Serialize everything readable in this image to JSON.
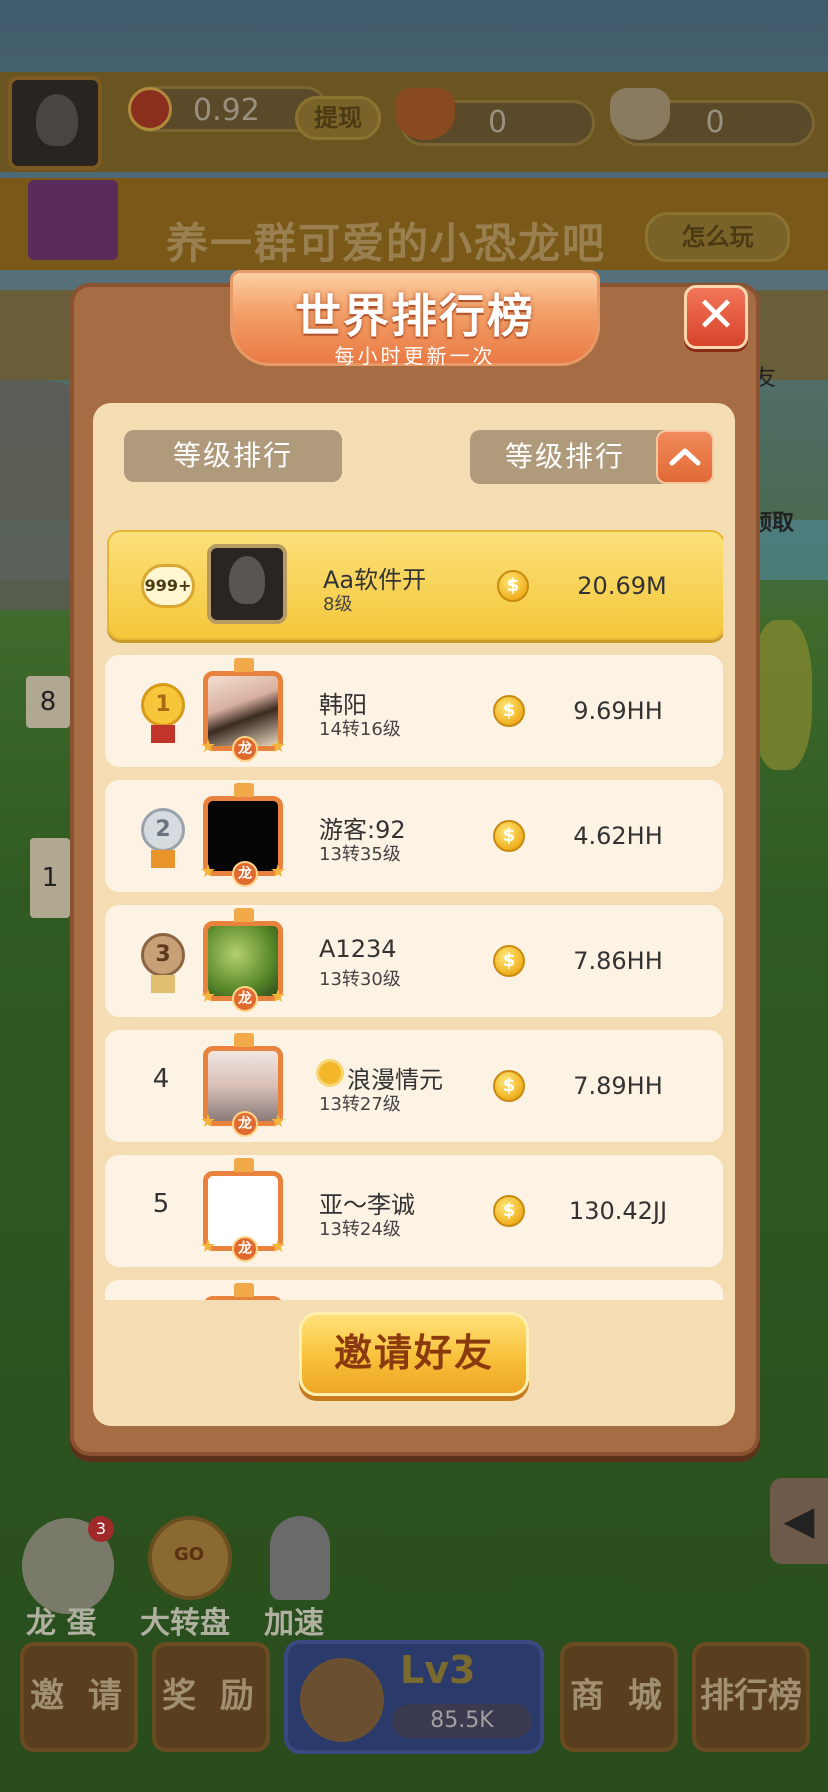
{
  "header": {
    "balance": "0.92",
    "withdraw_label": "提现",
    "counter1": "0",
    "counter2": "0"
  },
  "banner": {
    "text": "养一群可爱的小恐龙吧",
    "how_to_play": "怎么玩"
  },
  "scene": {
    "badge_a": "8",
    "badge_b": "1",
    "collect_label": "领取",
    "side_label": "友"
  },
  "dock": {
    "egg_label": "龙 蛋",
    "egg_count": "3",
    "wheel_label": "大转盘",
    "wheel_badge": "GO",
    "speed_label": "加速",
    "invite": "邀 请",
    "reward": "奖 励",
    "level": "Lv3",
    "coins": "85.5K",
    "shop": "商 城",
    "rank": "排行榜"
  },
  "modal": {
    "title": "世界排行榜",
    "subtitle": "每小时更新一次",
    "close_icon": "✕",
    "tab_left": "等级排行",
    "tab_right": "等级排行",
    "invite_button": "邀请好友",
    "coin_symbol": "$",
    "frame_badge": "龙",
    "my_row": {
      "rank": "999+",
      "name": "Aa软件开",
      "level": "8级",
      "score": "20.69M"
    },
    "rows": [
      {
        "rank": "1",
        "name": "韩阳",
        "level": "14转16级",
        "score": "9.69HH"
      },
      {
        "rank": "2",
        "name": "游客:92",
        "level": "13转35级",
        "score": "4.62HH"
      },
      {
        "rank": "3",
        "name": "A1234",
        "level": "13转30级",
        "score": "7.86HH"
      },
      {
        "rank": "4",
        "name": "浪漫情元",
        "name_icon": "sun-icon",
        "level": "13转27级",
        "score": "7.89HH"
      },
      {
        "rank": "5",
        "name": "亚～李诚",
        "level": "13转24级",
        "score": "130.42JJ"
      }
    ]
  },
  "colors": {
    "accent": "#e9753f",
    "gold": "#f4c73a",
    "panel": "#f4dcb3",
    "frame": "#a66d44"
  }
}
